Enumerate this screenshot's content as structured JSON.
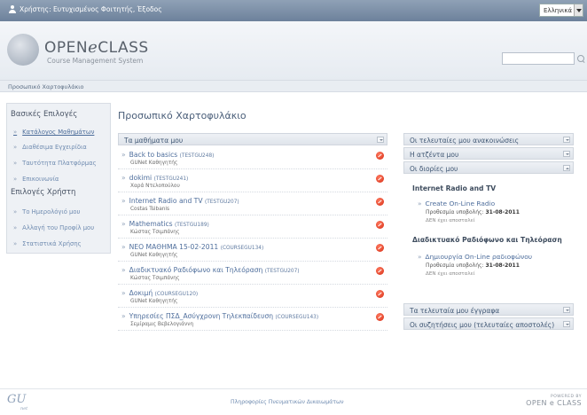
{
  "topbar": {
    "user_text": "Χρήστης: Ευτυχισμένος Φοιτητής, Έξοδος",
    "language": "Ελληνικά"
  },
  "header": {
    "logo_pre": "OPEN",
    "logo_e": "e",
    "logo_post": "CLASS",
    "logo_sub": "Course Management System",
    "search_value": ""
  },
  "breadcrumb": "Προσωπικό Χαρτοφυλάκιο",
  "sidebar": {
    "basic_heading": "Βασικές Επιλογές",
    "basic_items": [
      "Κατάλογος Μαθημάτων",
      "Διαθέσιμα Εγχειρίδια",
      "Ταυτότητα Πλατφόρμας",
      "Επικοινωνία"
    ],
    "user_heading": "Επιλογές Χρήστη",
    "user_items": [
      "Το Ημερολόγιό μου",
      "Αλλαγή του Προφίλ μου",
      "Στατιστικά Χρήσης"
    ]
  },
  "main": {
    "page_title": "Προσωπικό Χαρτοφυλάκιο",
    "courses_header": "Τα μαθήματα μου",
    "courses": [
      {
        "title": "Back to basics",
        "code": "(TESTGU248)",
        "prof": "GUNet Καθηγητής"
      },
      {
        "title": "dokimi",
        "code": "(TESTGU241)",
        "prof": "Χαρά Ντελοπούλου"
      },
      {
        "title": "Internet Radio and TV",
        "code": "(TESTGU207)",
        "prof": "Costas Tsibanis"
      },
      {
        "title": "Mathematics",
        "code": "(TESTGU189)",
        "prof": "Κώστας Τσιμπάνης"
      },
      {
        "title": "ΝΕΟ ΜΑΘΗΜΑ 15-02-2011",
        "code": "(COURSEGU134)",
        "prof": "GUNet Καθηγητής"
      },
      {
        "title": "Διαδικτυακό Ραδιόφωνο και Τηλεόραση",
        "code": "(TESTGU207)",
        "prof": "Κώστας Τσιμπάνης"
      },
      {
        "title": "Δοκιμή",
        "code": "(COURSEGU120)",
        "prof": "GUNet Καθηγητής"
      },
      {
        "title": "Υπηρεσίες ΠΣΔ_Ασύγχρονη Τηλεκπαίδευση",
        "code": "(COURSEGU143)",
        "prof": "Σεμίραμις Βεβελογιάννη"
      }
    ]
  },
  "right": {
    "announcements_header": "Οι τελευταίες μου ανακοινώσεις",
    "agenda_header": "Η ατζέντα μου",
    "assignments_header": "Οι διορίες μου",
    "groups": [
      {
        "course": "Internet Radio and TV",
        "title": "Create On-Line Radio",
        "deadline_label": "Προθεσμία υποβολής:",
        "deadline": "31-08-2011",
        "status": "ΔΕΝ έχει αποσταλεί"
      },
      {
        "course": "Διαδικτυακό Ραδιόφωνο και Τηλεόραση",
        "title": "Δημιουργία On-Line ραδιοφώνου",
        "deadline_label": "Προθεσμία υποβολής:",
        "deadline": "31-08-2011",
        "status": "ΔΕΝ έχει αποσταλεί"
      }
    ],
    "docs_header": "Τα τελευταία μου έγγραφα",
    "forum_header": "Οι συζητήσεις μου (τελευταίες αποστολές)"
  },
  "footer": {
    "gu_logo": "GU",
    "gu_sub": "net",
    "link": "Πληροφορίες Πνευματικών Δικαιωμάτων",
    "powered_by": "POWERED BY",
    "powered_name": "OPEN e CLASS"
  }
}
